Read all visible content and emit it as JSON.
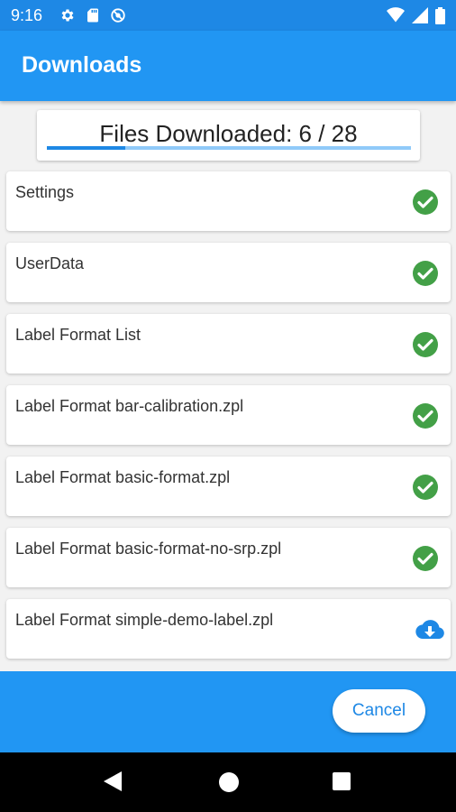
{
  "status_bar": {
    "time": "9:16",
    "icons_left": [
      "gear-icon",
      "sd-card-icon",
      "no-sync-icon"
    ],
    "icons_right": [
      "wifi-icon",
      "signal-icon",
      "battery-icon"
    ]
  },
  "app_bar": {
    "title": "Downloads"
  },
  "progress": {
    "label": "Files Downloaded: 6 / 28",
    "completed": 6,
    "total": 28,
    "fraction": 0.214
  },
  "items": [
    {
      "label": "Settings",
      "status": "done"
    },
    {
      "label": "UserData",
      "status": "done"
    },
    {
      "label": "Label Format List",
      "status": "done"
    },
    {
      "label": "Label Format bar-calibration.zpl",
      "status": "done"
    },
    {
      "label": "Label Format basic-format.zpl",
      "status": "done"
    },
    {
      "label": "Label Format basic-format-no-srp.zpl",
      "status": "done"
    },
    {
      "label": "Label Format simple-demo-label.zpl",
      "status": "downloading"
    }
  ],
  "bottom": {
    "cancel_label": "Cancel"
  },
  "colors": {
    "primary": "#2196f3",
    "status_bar": "#1e88e5",
    "success": "#43a047",
    "download": "#1e88e5"
  }
}
